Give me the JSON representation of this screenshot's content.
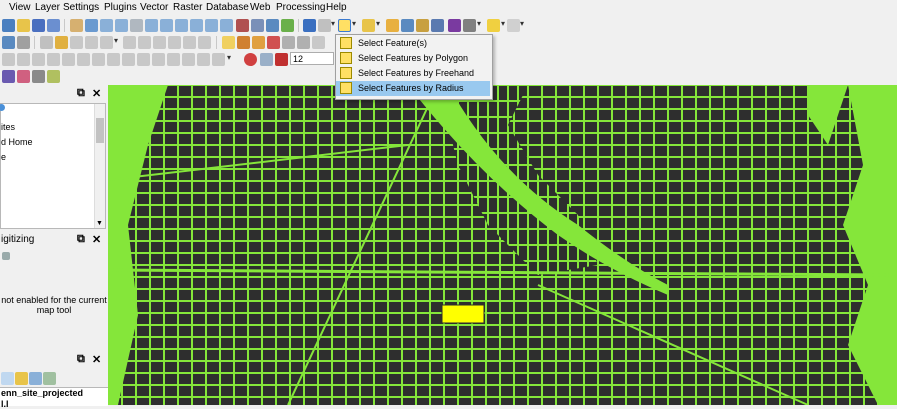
{
  "menubar": {
    "items": [
      "View",
      "Layer",
      "Settings",
      "Plugins",
      "Vector",
      "Raster",
      "Database",
      "Web",
      "Processing",
      "Help"
    ]
  },
  "toolbar": {
    "font_size_value": "12"
  },
  "select_menu": {
    "items": [
      {
        "label": "Select Feature(s)"
      },
      {
        "label": "Select Features by Polygon"
      },
      {
        "label": "Select Features by Freehand"
      },
      {
        "label": "Select Features by Radius"
      }
    ],
    "selected_index": 3
  },
  "panels": {
    "browser": {
      "items": [
        "ites",
        "d Home",
        "e"
      ]
    },
    "digitizing": {
      "title": "igitizing",
      "message_line1": "not enabled for the current",
      "message_line2": "map tool"
    },
    "layers": {
      "layer_name": "enn_site_projected",
      "layer_name2": "l.l"
    }
  },
  "map": {
    "land_color": "#85e63a",
    "block_color": "#2e2e2e",
    "highlight_color": "#ffff00"
  },
  "colors": {
    "menu_highlight": "#99c9ef",
    "toolbar_bg": "#f0f0f0"
  }
}
